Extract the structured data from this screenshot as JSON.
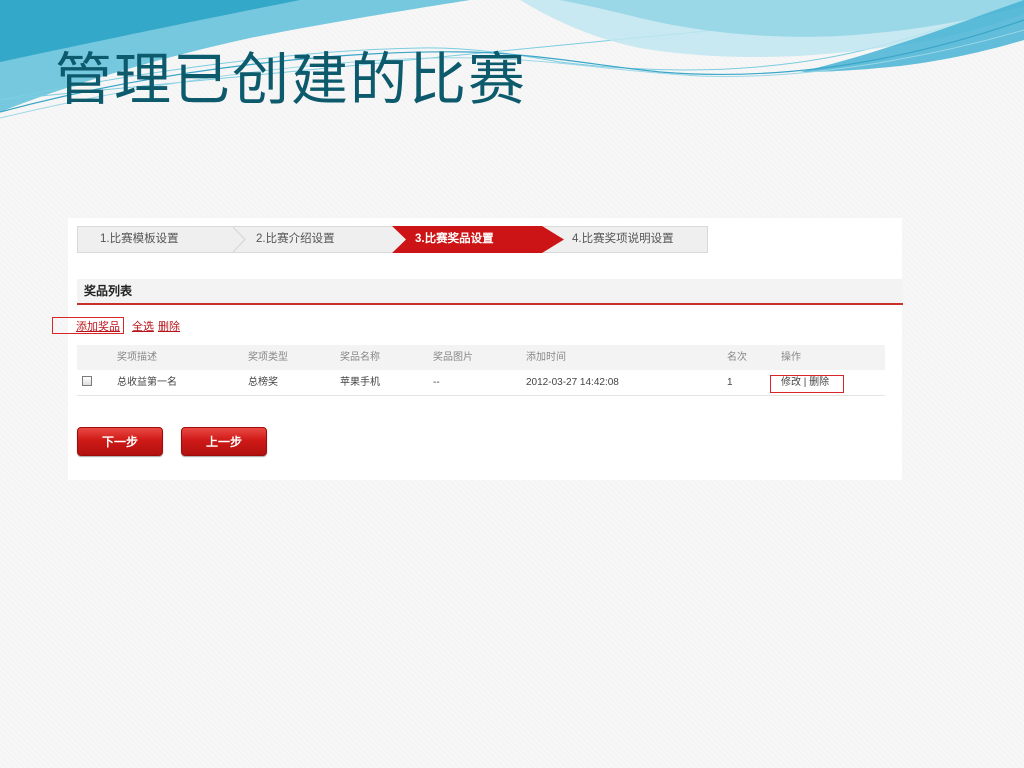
{
  "slide": {
    "title": "管理已创建的比赛"
  },
  "steps": [
    {
      "label": "1.比赛模板设置",
      "active": false
    },
    {
      "label": "2.比赛介绍设置",
      "active": false
    },
    {
      "label": "3.比赛奖品设置",
      "active": true
    },
    {
      "label": "4.比赛奖项说明设置",
      "active": false
    }
  ],
  "section": {
    "title": "奖品列表"
  },
  "actions": {
    "add_prize": "添加奖品",
    "select_all": "全选",
    "delete": "删除"
  },
  "table": {
    "columns": [
      "奖项描述",
      "奖项类型",
      "奖品名称",
      "奖品图片",
      "添加时间",
      "名次",
      "操作"
    ],
    "rows": [
      {
        "checked": false,
        "description": "总收益第一名",
        "type": "总榜奖",
        "name": "苹果手机",
        "image": "--",
        "added_time": "2012-03-27 14:42:08",
        "rank": "1",
        "edit": "修改",
        "separator": "|",
        "delete": "删除"
      }
    ]
  },
  "buttons": {
    "next": "下一步",
    "prev": "上一步"
  },
  "colors": {
    "title": "#0c5a6c",
    "accent": "#cc1417",
    "link": "#b8141a",
    "wave": "#57bfd9"
  }
}
